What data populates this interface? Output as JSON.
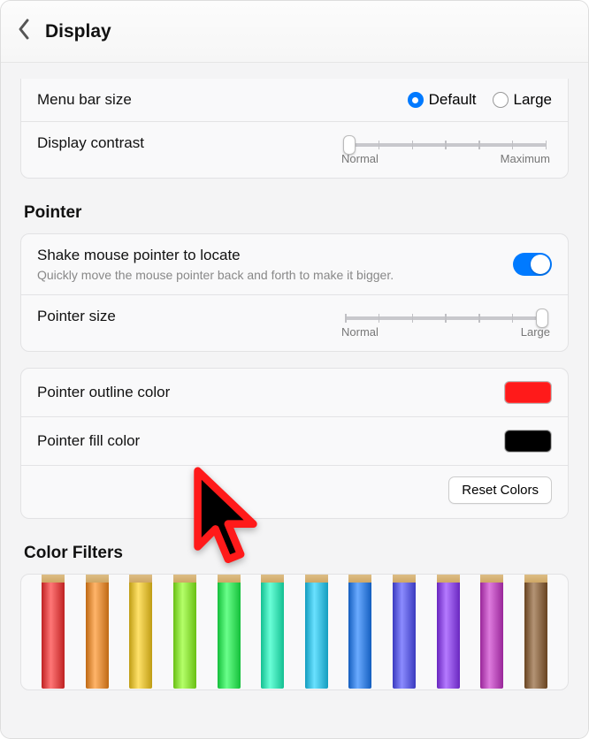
{
  "header": {
    "title": "Display"
  },
  "display": {
    "menu_bar_size": {
      "label": "Menu bar size",
      "options": [
        "Default",
        "Large"
      ],
      "selected": "Default"
    },
    "contrast": {
      "label": "Display contrast",
      "min_label": "Normal",
      "max_label": "Maximum",
      "value_pct": 0
    }
  },
  "pointer": {
    "section_title": "Pointer",
    "shake_locate": {
      "label": "Shake mouse pointer to locate",
      "description": "Quickly move the mouse pointer back and forth to make it bigger.",
      "enabled": true
    },
    "size": {
      "label": "Pointer size",
      "min_label": "Normal",
      "max_label": "Large",
      "value_pct": 100
    },
    "outline": {
      "label": "Pointer outline color",
      "color": "#ff1a1a"
    },
    "fill": {
      "label": "Pointer fill color",
      "color": "#000000"
    },
    "reset_label": "Reset Colors"
  },
  "color_filters": {
    "section_title": "Color Filters",
    "pencil_colors": [
      "#ff2d2d",
      "#ff8c1a",
      "#ffd11a",
      "#8cff1a",
      "#1aff4d",
      "#1affc2",
      "#1ad1ff",
      "#1a7dff",
      "#4d4dff",
      "#8c33ff",
      "#cc33cc",
      "#8b5a2b"
    ]
  }
}
